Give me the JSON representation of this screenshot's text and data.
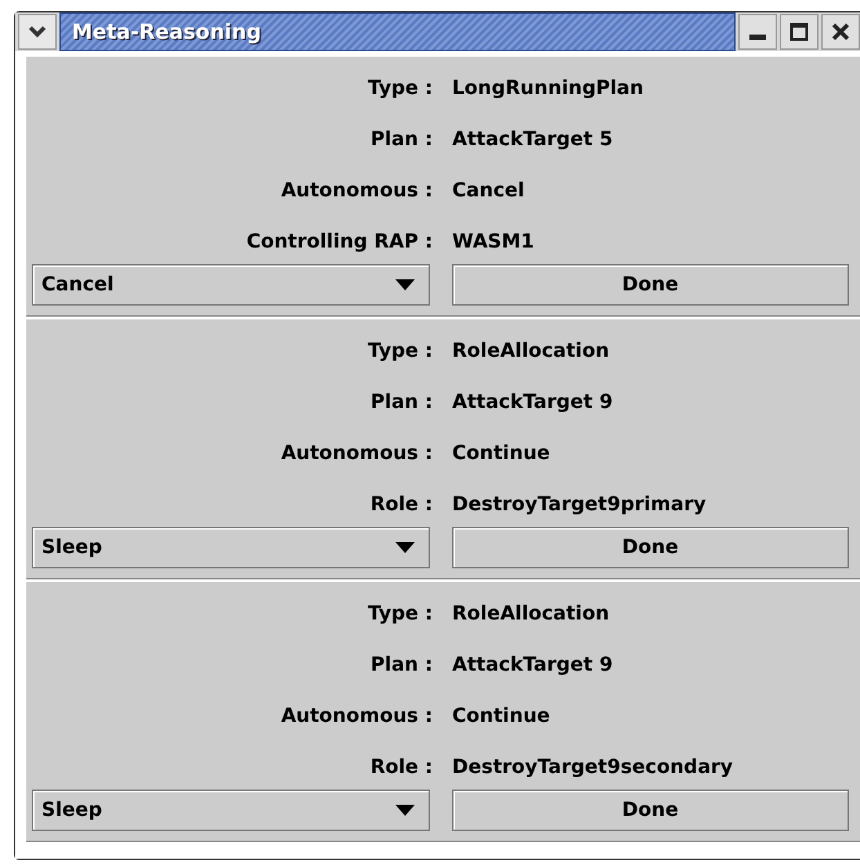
{
  "window": {
    "title": "Meta-Reasoning"
  },
  "panels": [
    {
      "fields": [
        {
          "label": "Type :",
          "value": "LongRunningPlan"
        },
        {
          "label": "Plan :",
          "value": "AttackTarget  5"
        },
        {
          "label": "Autonomous :",
          "value": "Cancel"
        },
        {
          "label": "Controlling RAP :",
          "value": "WASM1"
        }
      ],
      "choice": "Cancel",
      "button": "Done"
    },
    {
      "fields": [
        {
          "label": "Type :",
          "value": "RoleAllocation"
        },
        {
          "label": "Plan :",
          "value": "AttackTarget  9"
        },
        {
          "label": "Autonomous :",
          "value": "Continue"
        },
        {
          "label": "Role :",
          "value": "DestroyTarget9primary"
        }
      ],
      "choice": "Sleep",
      "button": "Done"
    },
    {
      "fields": [
        {
          "label": "Type :",
          "value": "RoleAllocation"
        },
        {
          "label": "Plan :",
          "value": "AttackTarget  9"
        },
        {
          "label": "Autonomous :",
          "value": "Continue"
        },
        {
          "label": "Role :",
          "value": "DestroyTarget9secondary"
        }
      ],
      "choice": "Sleep",
      "button": "Done"
    }
  ]
}
